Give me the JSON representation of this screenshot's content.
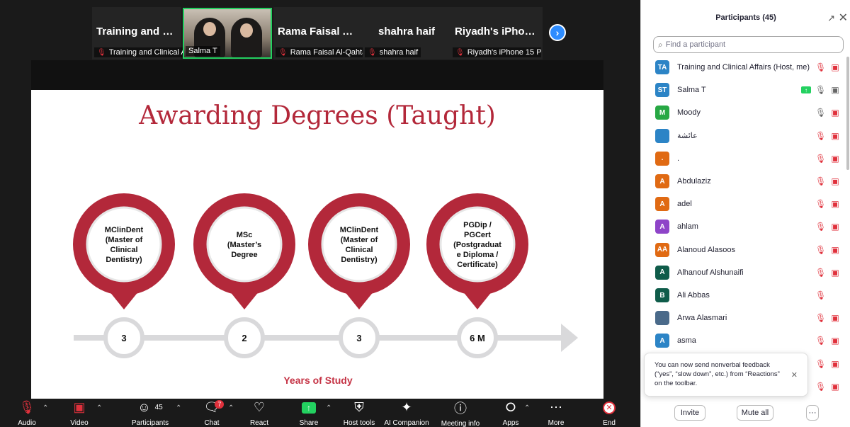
{
  "filmstrip": {
    "tiles": [
      {
        "big": "Training and Cli...",
        "label": "Training and Clinical Af..."
      },
      {
        "big": "",
        "label": "Salma T"
      },
      {
        "big": "Rama Faisal Al-...",
        "label": "Rama Faisal Al-Qahtani"
      },
      {
        "big": "shahra haif",
        "label": "shahra haif"
      },
      {
        "big": "Riyadh's iPhone...",
        "label": "Riyadh's iPhone 15 Pr..."
      }
    ],
    "next_icon": "chevron-right-icon"
  },
  "slide": {
    "title": "Awarding Degrees (Taught)",
    "pins": [
      {
        "lines": [
          "MClinDent",
          "(Master of",
          "Clinical",
          "Dentistry)"
        ],
        "years": "3"
      },
      {
        "lines": [
          "MSc",
          "(Master’s",
          "Degree"
        ],
        "years": "2"
      },
      {
        "lines": [
          "MClinDent",
          "(Master of",
          "Clinical",
          "Dentistry)"
        ],
        "years": "3"
      },
      {
        "lines": [
          "PGDip /",
          "PGCert",
          "(Postgraduat",
          "e Diploma /",
          "Certificate)"
        ],
        "years": "6 M"
      }
    ],
    "axis_label": "Years of Study",
    "accent": "#b3283a"
  },
  "toolbar": {
    "audio": "Audio",
    "video": "Video",
    "participants": "Participants",
    "participants_count": "45",
    "chat": "Chat",
    "chat_badge": "7",
    "react": "React",
    "share": "Share",
    "host_tools": "Host tools",
    "ai_companion": "AI Companion",
    "meeting_info": "Meeting info",
    "apps": "Apps",
    "more": "More",
    "end": "End"
  },
  "panel": {
    "title": "Participants (45)",
    "search_placeholder": "Find a participant",
    "participants": [
      {
        "initials": "TA",
        "name": "Training and Clinical Affairs (Host, me)",
        "color": "#2c84c6",
        "audio": "muted",
        "video": "off"
      },
      {
        "initials": "ST",
        "name": "Salma T",
        "color": "#2c84c6",
        "audio": "on",
        "video": "on",
        "sharing": true
      },
      {
        "initials": "M",
        "name": "Moody",
        "color": "#27a844",
        "audio": "on",
        "video": "off"
      },
      {
        "initials": "",
        "name": "عائشة",
        "color": "#2c84c6",
        "audio": "muted",
        "video": "off"
      },
      {
        "initials": ".",
        "name": ".",
        "color": "#e06a13",
        "audio": "muted",
        "video": "off"
      },
      {
        "initials": "A",
        "name": "Abdulaziz",
        "color": "#e06a13",
        "audio": "muted",
        "video": "off"
      },
      {
        "initials": "A",
        "name": "adel",
        "color": "#e06a13",
        "audio": "muted",
        "video": "off"
      },
      {
        "initials": "A",
        "name": "ahlam",
        "color": "#8e44c8",
        "audio": "muted",
        "video": "off"
      },
      {
        "initials": "AA",
        "name": "Alanoud Alasoos",
        "color": "#e06a13",
        "audio": "muted",
        "video": "off"
      },
      {
        "initials": "A",
        "name": "Alhanouf Alshunaifi",
        "color": "#0f5c4a",
        "audio": "muted",
        "video": "off"
      },
      {
        "initials": "B",
        "name": "Ali Abbas",
        "color": "#0f5c4a",
        "audio": "muted",
        "video": "none"
      },
      {
        "initials": "",
        "name": "Arwa Alasmari",
        "color": "#4a6a8a",
        "audio": "muted",
        "video": "off"
      },
      {
        "initials": "A",
        "name": "asma",
        "color": "#2c84c6",
        "audio": "muted",
        "video": "off"
      }
    ],
    "extra_row_icons": 2,
    "tooltip": "You can now send nonverbal feedback (“yes”, “slow down”, etc.) from “Reactions” on the toolbar.",
    "invite": "Invite",
    "mute_all": "Mute all",
    "more": "···"
  }
}
